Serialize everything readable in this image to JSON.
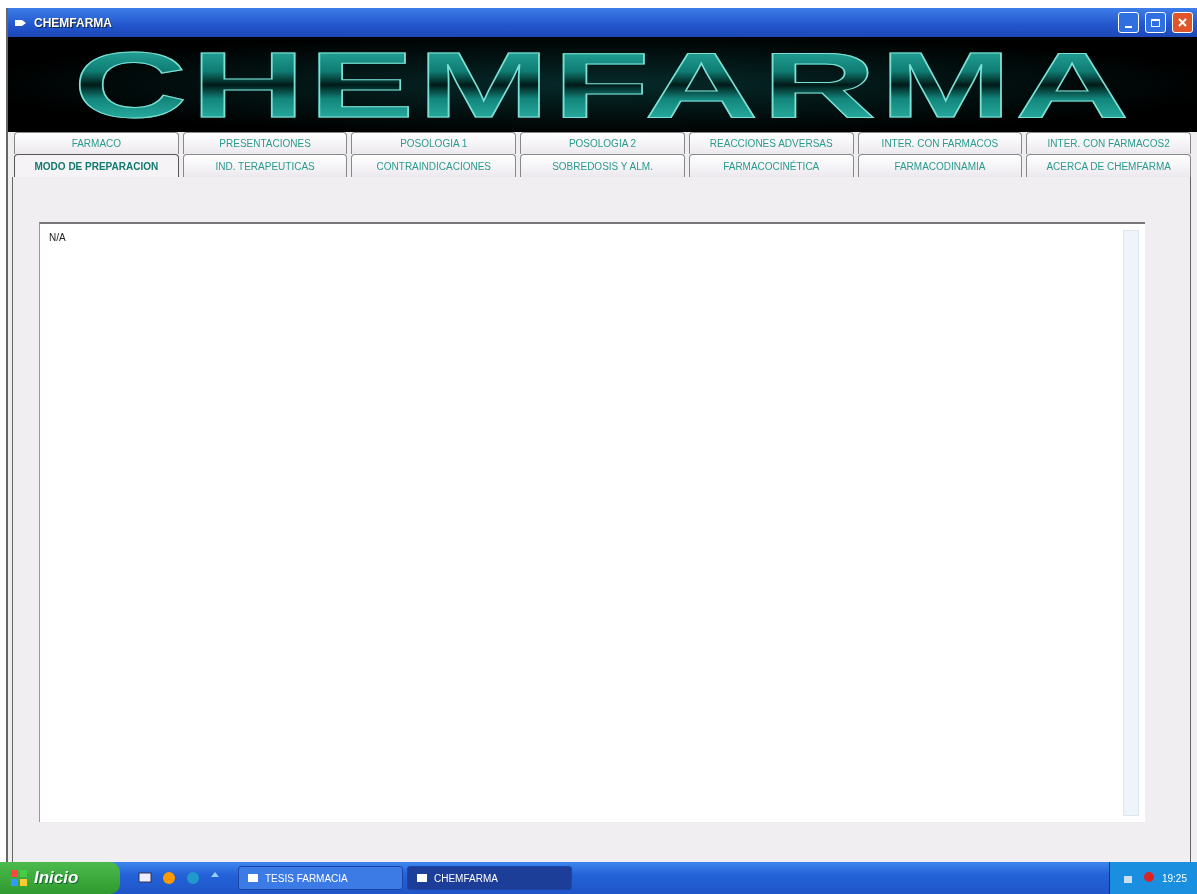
{
  "window": {
    "title": "CHEMFARMA"
  },
  "logo": {
    "text": "CHEMFARMA"
  },
  "tabs_row_1": [
    {
      "label": "FARMACO",
      "selected": false
    },
    {
      "label": "PRESENTACIONES",
      "selected": false
    },
    {
      "label": "POSOLOGIA 1",
      "selected": false
    },
    {
      "label": "POSOLOGIA 2",
      "selected": false
    },
    {
      "label": "REACCIONES ADVERSAS",
      "selected": false
    },
    {
      "label": "INTER. CON FARMACOS",
      "selected": false
    },
    {
      "label": "INTER. CON FARMACOS2",
      "selected": false
    }
  ],
  "tabs_row_2": [
    {
      "label": "MODO DE PREPARACION",
      "selected": true
    },
    {
      "label": "IND. TERAPEUTICAS",
      "selected": false
    },
    {
      "label": "CONTRAINDICACIONES",
      "selected": false
    },
    {
      "label": "SOBREDOSIS Y ALM.",
      "selected": false
    },
    {
      "label": "FARMACOCINÉTICA",
      "selected": false
    },
    {
      "label": "FARMACODINAMIA",
      "selected": false
    },
    {
      "label": "ACERCA DE CHEMFARMA",
      "selected": false
    }
  ],
  "text_area": {
    "value": "N/A"
  },
  "taskbar": {
    "start": "Inicio",
    "tasks": [
      {
        "label": "TESIS FARMACIA",
        "selected": false
      },
      {
        "label": "CHEMFARMA",
        "selected": true
      }
    ],
    "clock": "19:25"
  }
}
